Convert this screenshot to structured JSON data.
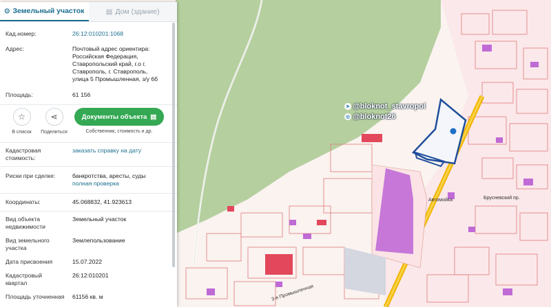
{
  "tabs": {
    "land": "Земельный участок",
    "building": "Дом (здание)"
  },
  "info": {
    "cad_number_label": "Кад.номер:",
    "cad_number": "26:12:010201:1068",
    "address_label": "Адрес:",
    "address_lines": [
      "Почтовый адрес ориентира:",
      "Российская Федерация,",
      "Ставропольский край, г.о г.",
      "Ставрополь, г. Ставрополь,",
      "улица 5 Промышленная, з/у 6б"
    ],
    "area_label": "Площадь:",
    "area": "61 156"
  },
  "actions": {
    "list_label": "В список",
    "share_label": "Поделиться",
    "docs_button": "Документы объекта",
    "docs_sub": "Собственник, стоимость и др."
  },
  "details": {
    "cost_label_1": "Кадастровая",
    "cost_label_2": "стоимость:",
    "cost_link": "заказать справку на дату",
    "risks_label": "Риски при сделке:",
    "risks_text": "банкротства, аресты, суды",
    "risks_link": "полная проверка",
    "coords_label": "Координаты:",
    "coords": "45.068832, 41.923613",
    "obj_type_label_1": "Вид объекта",
    "obj_type_label_2": "недвижимости",
    "obj_type": "Земельный участок",
    "land_use_label_1": "Вид земельного",
    "land_use_label_2": "участка",
    "land_use": "Землепользование",
    "date_label": "Дата присвоения",
    "date": "15.07.2022",
    "quarter_label_1": "Кадастровый",
    "quarter_label_2": "квартал",
    "quarter": "26:12:010201",
    "refined_area_label": "Площадь уточненная",
    "refined_area": "61156 кв. м"
  },
  "overlay": {
    "channel_1": "@bloknot_stavropol",
    "channel_2": "@bloknot26"
  },
  "map_labels": {
    "street_1": "3-я Промышленная",
    "place_1": "Автомойка",
    "place_2": "Брусневский пр."
  },
  "colors": {
    "accent": "#1a6e8e",
    "docs_green": "#34a853",
    "parcel_outline": "#1f4e9a",
    "green_zone": "#b5cf9f",
    "purple_building": "#c06ad6"
  },
  "icons": {
    "land_tab": "pin-icon",
    "building_tab": "building-icon",
    "list": "star-icon",
    "share": "share-icon",
    "docs": "document-icon",
    "telegram": "telegram-icon",
    "instagram": "instagram-icon"
  }
}
